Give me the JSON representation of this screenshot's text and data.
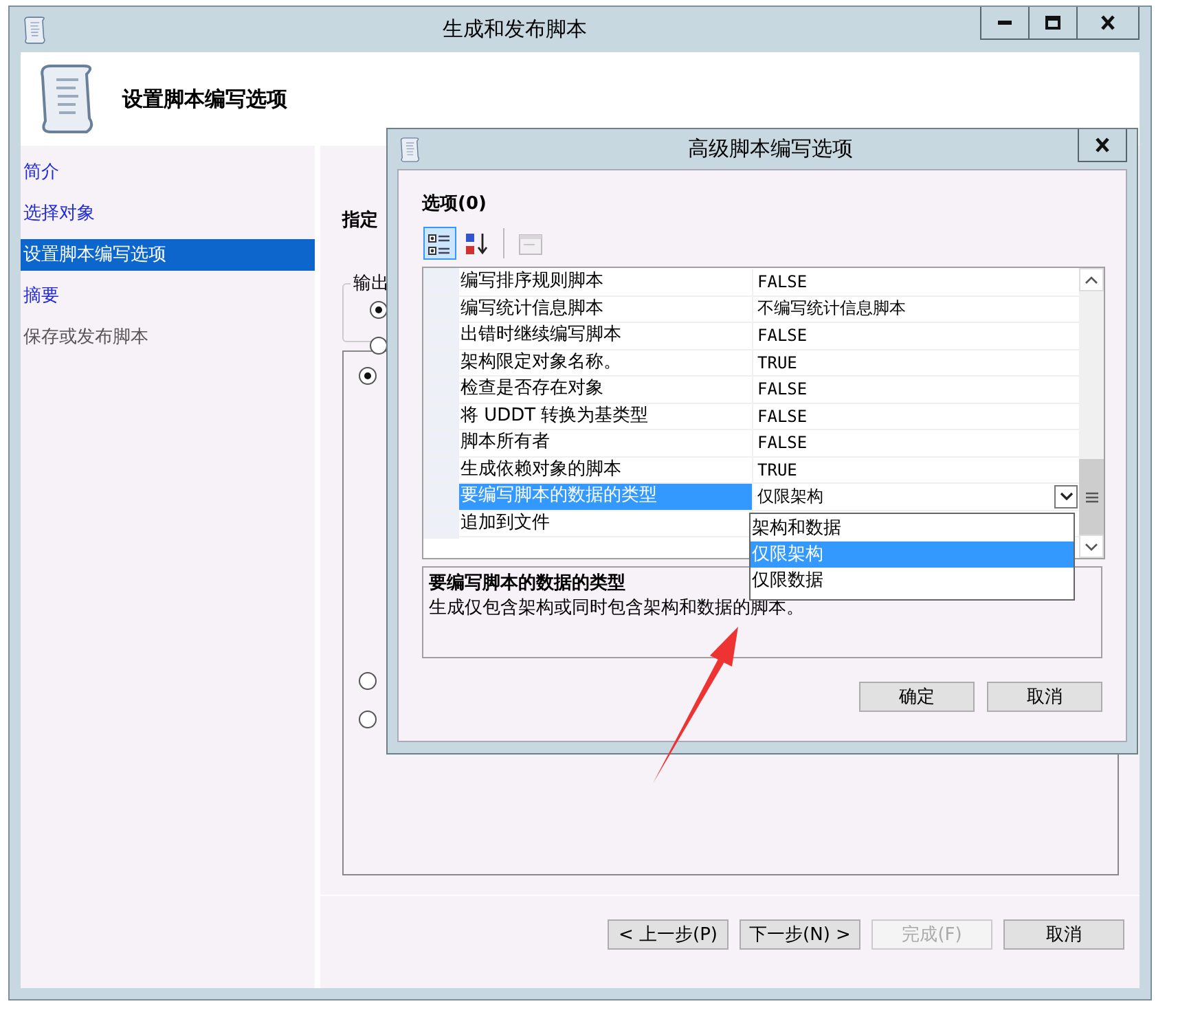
{
  "window": {
    "title": "生成和发布脚本"
  },
  "header": {
    "title": "设置脚本编写选项"
  },
  "nav": [
    {
      "label": "简介",
      "selected": false,
      "disabled": false
    },
    {
      "label": "选择对象",
      "selected": false,
      "disabled": false
    },
    {
      "label": "设置脚本编写选项",
      "selected": true,
      "disabled": false
    },
    {
      "label": "摘要",
      "selected": false,
      "disabled": false
    },
    {
      "label": "保存或发布脚本",
      "selected": false,
      "disabled": true
    }
  ],
  "page": {
    "heading": "指定",
    "output_group": {
      "label": "输出",
      "radios": [
        {
          "selected": true
        },
        {
          "selected": false
        }
      ]
    },
    "option_radios": [
      {
        "selected": true
      },
      {
        "selected": false
      },
      {
        "selected": false
      }
    ]
  },
  "footer_buttons": [
    {
      "label": "< 上一步(P)",
      "disabled": false
    },
    {
      "label": "下一步(N) >",
      "disabled": false
    },
    {
      "label": "完成(F)",
      "disabled": true
    },
    {
      "label": "取消",
      "disabled": false
    }
  ],
  "dialog": {
    "title": "高级脚本编写选项",
    "section": "选项(0)",
    "toolbar": [
      {
        "kind": "categorized",
        "selected": true,
        "disabled": false
      },
      {
        "kind": "alphabetical",
        "selected": false,
        "disabled": false
      },
      {
        "kind": "property-pages",
        "selected": false,
        "disabled": true
      }
    ],
    "properties": [
      {
        "name": "编写排序规则脚本",
        "value": "FALSE",
        "selected": false
      },
      {
        "name": "编写统计信息脚本",
        "value": "不编写统计信息脚本",
        "selected": false
      },
      {
        "name": "出错时继续编写脚本",
        "value": "FALSE",
        "selected": false
      },
      {
        "name": "架构限定对象名称。",
        "value": "TRUE",
        "selected": false
      },
      {
        "name": "检查是否存在对象",
        "value": "FALSE",
        "selected": false
      },
      {
        "name": "将 UDDT 转换为基类型",
        "value": "FALSE",
        "selected": false
      },
      {
        "name": "脚本所有者",
        "value": "FALSE",
        "selected": false
      },
      {
        "name": "生成依赖对象的脚本",
        "value": "TRUE",
        "selected": false
      },
      {
        "name": "要编写脚本的数据的类型",
        "value": "仅限架构",
        "selected": true
      },
      {
        "name": "追加到文件",
        "selected": false
      }
    ],
    "dropdown": {
      "options": [
        {
          "label": "架构和数据",
          "selected": false
        },
        {
          "label": "仅限架构",
          "selected": true
        },
        {
          "label": "仅限数据",
          "selected": false
        }
      ]
    },
    "description": {
      "title": "要编写脚本的数据的类型",
      "text": "生成仅包含架构或同时包含架构和数据的脚本。"
    },
    "buttons": [
      {
        "label": "确定"
      },
      {
        "label": "取消"
      }
    ]
  }
}
